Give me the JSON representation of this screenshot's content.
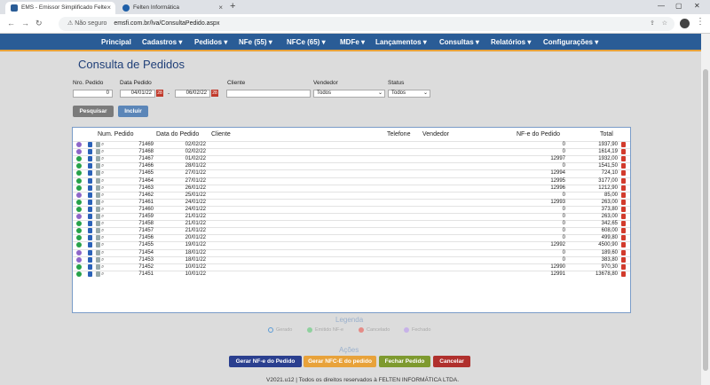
{
  "browser": {
    "tab1": "EMS - Emissor Simplificado Felte",
    "tab2": "Felten Informática",
    "security": "Não seguro",
    "url": "emsfi.com.br/lva/ConsultaPedido.aspx"
  },
  "nav": [
    "Principal",
    "Cadastros ▾",
    "Pedidos ▾",
    "NFe (55) ▾",
    "NFCe (65) ▾",
    "MDFe ▾",
    "Lançamentos ▾",
    "Consultas ▾",
    "Relatórios ▾",
    "Configurações ▾"
  ],
  "page": {
    "title": "Consulta de Pedidos"
  },
  "filters": {
    "nro_label": "Nro. Pedido",
    "nro_value": "0",
    "data_label": "Data Pedido",
    "date_from": "04/01/22",
    "date_to": "06/02/22",
    "date_sep": "-",
    "cliente_label": "Cliente",
    "vendedor_label": "Vendedor",
    "vendedor_value": "Todos",
    "status_label": "Status",
    "status_value": "Todos"
  },
  "buttons": {
    "pesquisar": "Pesquisar",
    "incluir": "Incluir"
  },
  "grid": {
    "headers": {
      "num": "Num. Pedido",
      "data": "Data do Pedido",
      "cliente": "Cliente",
      "telefone": "Telefone",
      "vendedor": "Vendedor",
      "nfe": "NF-e do Pedido",
      "total": "Total"
    },
    "rows": [
      {
        "num": "71469",
        "data": "02/02/22",
        "nfe": "0",
        "total": "1937,90",
        "status": "f"
      },
      {
        "num": "71468",
        "data": "02/02/22",
        "nfe": "0",
        "total": "1614,19",
        "status": "f"
      },
      {
        "num": "71467",
        "data": "01/02/22",
        "nfe": "12997",
        "total": "1932,00",
        "status": "e"
      },
      {
        "num": "71466",
        "data": "28/01/22",
        "nfe": "0",
        "total": "1541,50",
        "status": "e"
      },
      {
        "num": "71465",
        "data": "27/01/22",
        "nfe": "12994",
        "total": "724,10",
        "status": "e"
      },
      {
        "num": "71464",
        "data": "27/01/22",
        "nfe": "12995",
        "total": "3177,00",
        "status": "e"
      },
      {
        "num": "71463",
        "data": "26/01/22",
        "nfe": "12996",
        "total": "1212,90",
        "status": "e"
      },
      {
        "num": "71462",
        "data": "25/01/22",
        "nfe": "0",
        "total": "85,00",
        "status": "f"
      },
      {
        "num": "71461",
        "data": "24/01/22",
        "nfe": "12993",
        "total": "263,00",
        "status": "e"
      },
      {
        "num": "71460",
        "data": "24/01/22",
        "nfe": "0",
        "total": "373,80",
        "status": "e"
      },
      {
        "num": "71459",
        "data": "21/01/22",
        "nfe": "0",
        "total": "263,00",
        "status": "f"
      },
      {
        "num": "71458",
        "data": "21/01/22",
        "nfe": "0",
        "total": "342,65",
        "status": "e"
      },
      {
        "num": "71457",
        "data": "21/01/22",
        "nfe": "0",
        "total": "608,00",
        "status": "e"
      },
      {
        "num": "71456",
        "data": "20/01/22",
        "nfe": "0",
        "total": "499,80",
        "status": "e"
      },
      {
        "num": "71455",
        "data": "19/01/22",
        "nfe": "12992",
        "total": "4500,90",
        "status": "e"
      },
      {
        "num": "71454",
        "data": "18/01/22",
        "nfe": "0",
        "total": "189,60",
        "status": "f"
      },
      {
        "num": "71453",
        "data": "18/01/22",
        "nfe": "0",
        "total": "383,80",
        "status": "f"
      },
      {
        "num": "71452",
        "data": "10/01/22",
        "nfe": "12990",
        "total": "970,30",
        "status": "e"
      },
      {
        "num": "71451",
        "data": "10/01/22",
        "nfe": "12991",
        "total": "13678,80",
        "status": "e"
      }
    ]
  },
  "legend": {
    "title": "Legenda",
    "items": [
      "Gerado",
      "Emitido NF-e",
      "Cancelado",
      "Fechado"
    ]
  },
  "acoes": {
    "title": "Ações",
    "gerar_nfe": "Gerar NF-e do Pedido",
    "gerar_nfce": "Gerar NFC-E do pedido",
    "fechar": "Fechar Pedido",
    "cancelar": "Cancelar"
  },
  "footer": "V2021.u12 | Todos os direitos reservados à FELTEN INFORMÁTICA LTDA.",
  "colors": {
    "nav": "#2a5c96",
    "emitido": "#27a24a",
    "fechado": "#8e66c9",
    "pdf": "#d23b2c"
  }
}
